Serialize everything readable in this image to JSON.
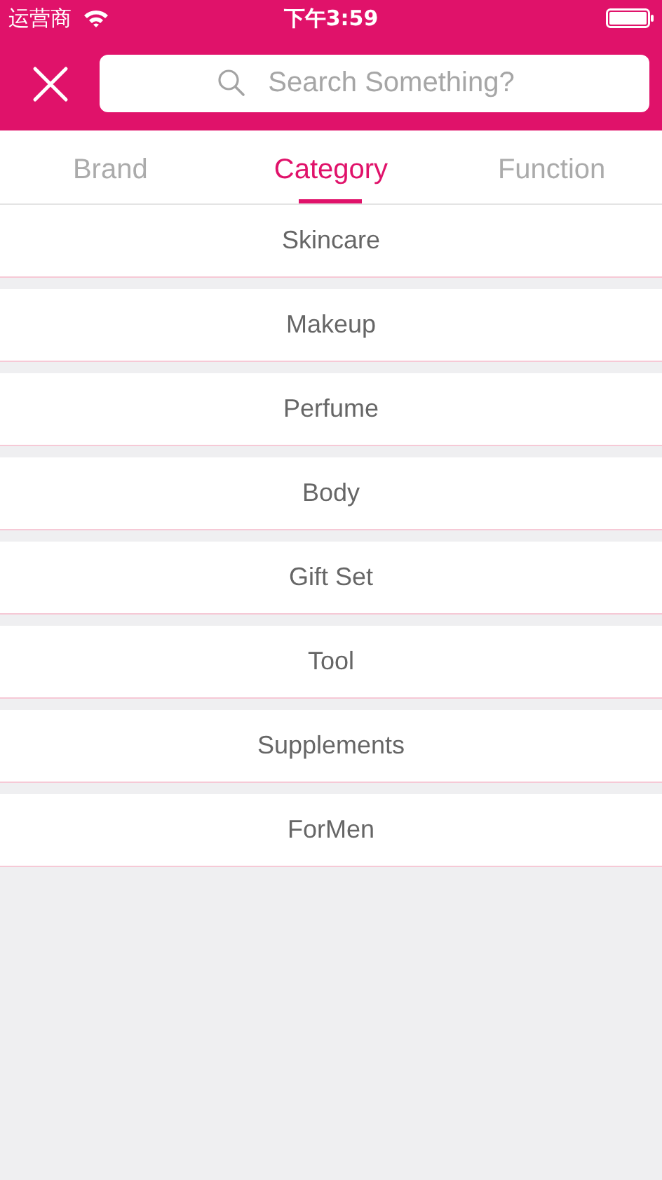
{
  "status_bar": {
    "carrier": "运营商",
    "time": "下午3:59"
  },
  "search": {
    "placeholder": "Search Something?"
  },
  "tabs": [
    {
      "label": "Brand",
      "selected": false
    },
    {
      "label": "Category",
      "selected": true
    },
    {
      "label": "Function",
      "selected": false
    }
  ],
  "categories": [
    {
      "label": "Skincare"
    },
    {
      "label": "Makeup"
    },
    {
      "label": "Perfume"
    },
    {
      "label": "Body"
    },
    {
      "label": "Gift Set"
    },
    {
      "label": "Tool"
    },
    {
      "label": "Supplements"
    },
    {
      "label": "ForMen"
    }
  ]
}
